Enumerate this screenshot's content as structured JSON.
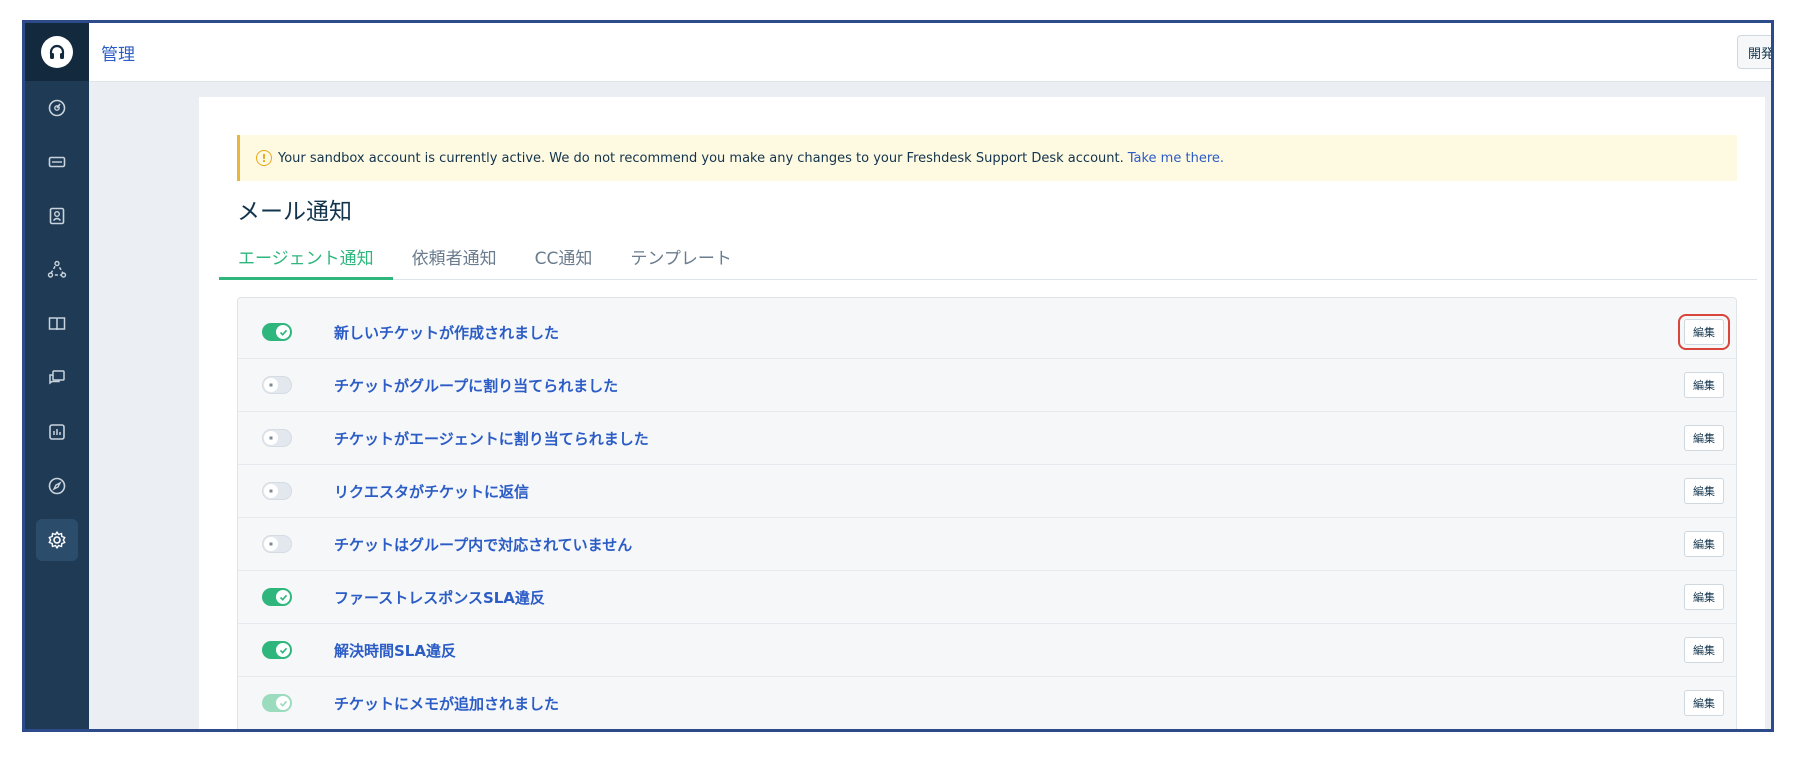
{
  "topbar": {
    "title": "管理",
    "right_button_label": "開発"
  },
  "sidebar": {
    "items": [
      {
        "icon": "dashboard-icon"
      },
      {
        "icon": "ticket-icon"
      },
      {
        "icon": "contacts-icon"
      },
      {
        "icon": "groups-icon"
      },
      {
        "icon": "solutions-book-icon"
      },
      {
        "icon": "forums-icon"
      },
      {
        "icon": "reports-icon"
      },
      {
        "icon": "discover-compass-icon"
      },
      {
        "icon": "gear-icon",
        "active": true
      }
    ]
  },
  "banner": {
    "text": "Your sandbox account is currently active. We do not recommend you make any changes to your Freshdesk Support Desk account.",
    "link": "Take me there."
  },
  "page": {
    "title": "メール通知"
  },
  "tabs": [
    {
      "label": "エージェント通知",
      "active": true
    },
    {
      "label": "依頼者通知"
    },
    {
      "label": "CC通知"
    },
    {
      "label": "テンプレート"
    }
  ],
  "notifications": [
    {
      "label": "新しいチケットが作成されました",
      "enabled": true,
      "edit": "編集"
    },
    {
      "label": "チケットがグループに割り当てられました",
      "enabled": false,
      "edit": "編集"
    },
    {
      "label": "チケットがエージェントに割り当てられました",
      "enabled": false,
      "edit": "編集"
    },
    {
      "label": "リクエスタがチケットに返信",
      "enabled": false,
      "edit": "編集"
    },
    {
      "label": "チケットはグループ内で対応されていません",
      "enabled": false,
      "edit": "編集"
    },
    {
      "label": "ファーストレスポンスSLA違反",
      "enabled": true,
      "edit": "編集"
    },
    {
      "label": "解決時間SLA違反",
      "enabled": true,
      "edit": "編集"
    },
    {
      "label": "チケットにメモが追加されました",
      "enabled": true,
      "disabled_look": true,
      "edit": "編集"
    }
  ],
  "colors": {
    "accent_green": "#2eb67d",
    "link_blue": "#2c5cc5",
    "sidebar": "#1f3a54",
    "highlight_red": "#d9443b"
  }
}
